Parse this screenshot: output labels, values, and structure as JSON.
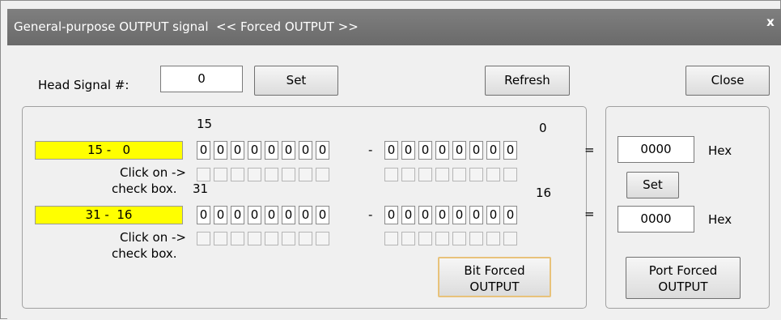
{
  "window": {
    "title": "General-purpose OUTPUT signal  << Forced OUTPUT >>",
    "close_glyph": "x"
  },
  "head": {
    "label": "Head Signal #:",
    "value": "0",
    "set": "Set",
    "refresh": "Refresh",
    "close": "Close"
  },
  "bits": {
    "row1": {
      "label": "15 -   0",
      "left_num": "15",
      "right_num": "0",
      "high_values": [
        "0",
        "0",
        "0",
        "0",
        "0",
        "0",
        "0",
        "0"
      ],
      "low_values": [
        "0",
        "0",
        "0",
        "0",
        "0",
        "0",
        "0",
        "0"
      ]
    },
    "row2": {
      "label": "31 -  16",
      "left_num": "31",
      "right_num": "16",
      "high_values": [
        "0",
        "0",
        "0",
        "0",
        "0",
        "0",
        "0",
        "0"
      ],
      "low_values": [
        "0",
        "0",
        "0",
        "0",
        "0",
        "0",
        "0",
        "0"
      ]
    },
    "dash": "-",
    "click_hint_line1": "Click on ->",
    "click_hint_line2": "check box.",
    "bit_forced_line1": "Bit Forced",
    "bit_forced_line2": "OUTPUT"
  },
  "port": {
    "equals": "=",
    "hex1": "0000",
    "hex2": "0000",
    "hex_label": "Hex",
    "set": "Set",
    "port_forced_line1": "Port Forced",
    "port_forced_line2": "OUTPUT"
  },
  "colors": {
    "label_highlight": "#ffff00",
    "focus_border": "#e8c27a"
  }
}
